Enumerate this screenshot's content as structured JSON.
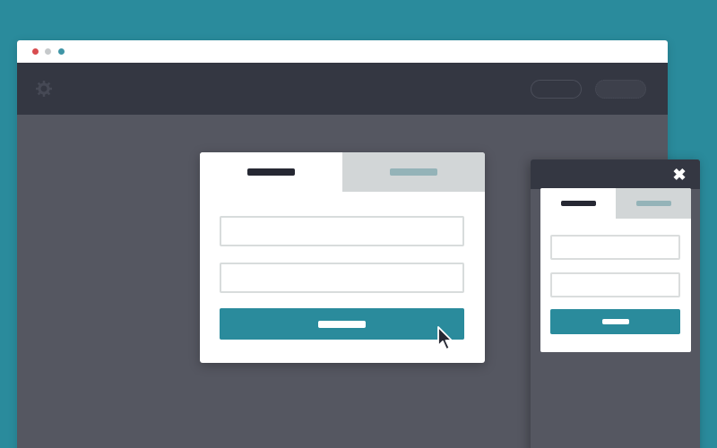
{
  "browser": {
    "window_dots": [
      "red",
      "gray",
      "teal"
    ],
    "colors": {
      "red": "#d84c4f",
      "gray": "#c6c9cb",
      "teal": "#3f95a6"
    }
  },
  "site_header": {
    "logo_icon": "gear-icon",
    "buttons": [
      {
        "name": "outline-header-button",
        "label": ""
      },
      {
        "name": "filled-header-button",
        "label": ""
      }
    ]
  },
  "modal": {
    "tabs": [
      {
        "label": "",
        "active": true
      },
      {
        "label": "",
        "active": false
      }
    ],
    "fields": [
      {
        "value": "",
        "placeholder": ""
      },
      {
        "value": "",
        "placeholder": ""
      }
    ],
    "submit_label": ""
  },
  "mobile": {
    "close_icon": "close-icon",
    "close_glyph": "✖",
    "tabs": [
      {
        "label": "",
        "active": true
      },
      {
        "label": "",
        "active": false
      }
    ],
    "fields": [
      {
        "value": "",
        "placeholder": ""
      },
      {
        "value": "",
        "placeholder": ""
      }
    ],
    "submit_label": ""
  },
  "colors": {
    "background": "#2a8b9c",
    "accent": "#2a8b9c",
    "header_dark": "#343742",
    "page_gray": "#555761",
    "inactive_tab": "#d2d6d7"
  }
}
